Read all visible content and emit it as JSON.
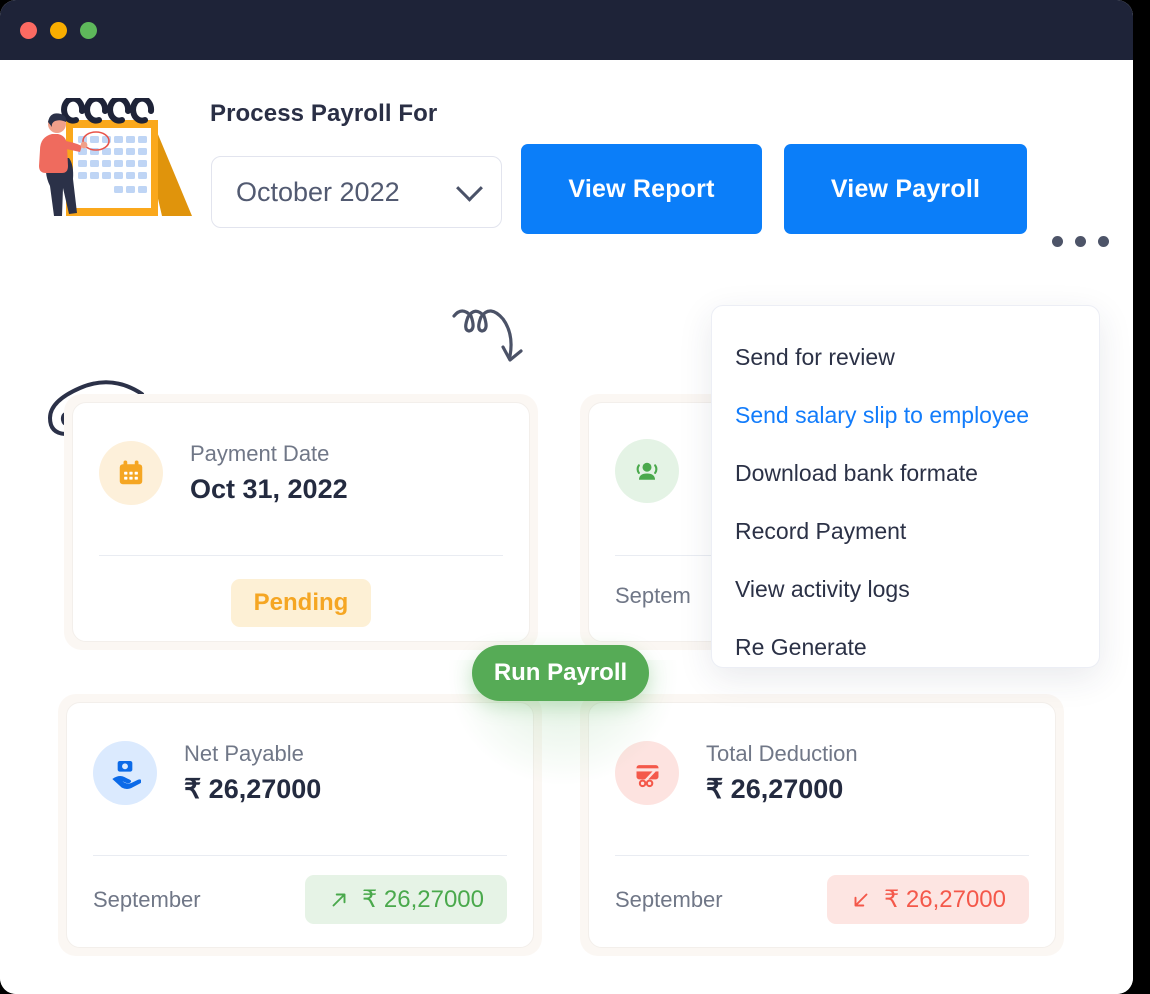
{
  "window": {
    "traffic_lights": [
      "close",
      "minimize",
      "maximize"
    ]
  },
  "header": {
    "title": "Process Payroll For",
    "month_select": {
      "value": "October 2022",
      "icon": "chevron-down-icon"
    },
    "view_report_label": "View Report",
    "view_payroll_label": "View Payroll",
    "more_icon": "ellipsis-horizontal-icon"
  },
  "dropdown": {
    "items": [
      {
        "label": "Send for review",
        "active": false
      },
      {
        "label": "Send salary slip to employee",
        "active": true
      },
      {
        "label": "Download bank formate",
        "active": false
      },
      {
        "label": "Record Payment",
        "active": false
      },
      {
        "label": "View activity logs",
        "active": false
      },
      {
        "label": "Re Generate",
        "active": false
      }
    ]
  },
  "cards": {
    "payment_date": {
      "icon": "calendar-icon",
      "label": "Payment Date",
      "value": "Oct 31, 2022",
      "status": "Pending"
    },
    "employees": {
      "icon": "people-icon",
      "label": "",
      "value": "",
      "footer_month": "Septem"
    },
    "net_payable": {
      "icon": "money-in-hand-icon",
      "label": "Net Payable",
      "value": "₹ 26,27000",
      "footer_month": "September",
      "trend_icon": "arrow-up-right-icon",
      "trend_value": "₹ 26,27000"
    },
    "total_deduction": {
      "icon": "card-cut-icon",
      "label": "Total Deduction",
      "value": "₹ 26,27000",
      "footer_month": "September",
      "trend_icon": "arrow-down-left-icon",
      "trend_value": "₹ 26,27000"
    }
  },
  "run_payroll_label": "Run Payroll",
  "colors": {
    "titlebar": "#1e2338",
    "primary_blue": "#0b7ef9",
    "link_blue": "#127cfb",
    "green": "#56ab56",
    "pending_orange": "#f5a623",
    "red": "#f4584a",
    "card_wrap": "#fbf7f3"
  }
}
